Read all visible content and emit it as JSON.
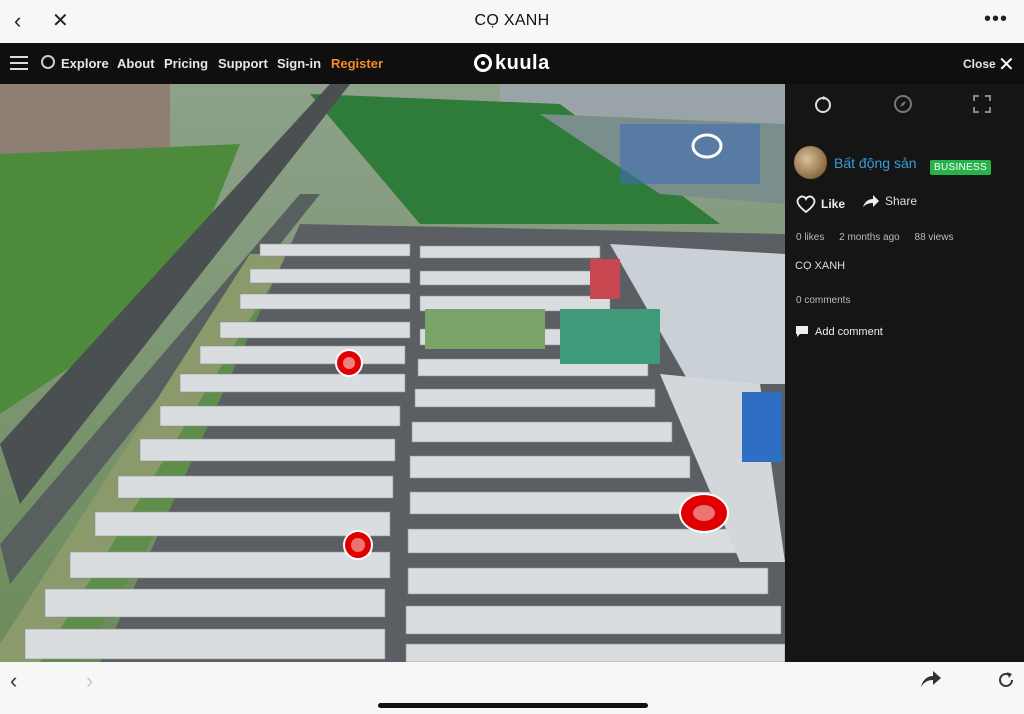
{
  "browser": {
    "title": "CỌ XANH",
    "back_icon": "chevron-left-icon",
    "close_icon": "close-icon",
    "more_label": "•••"
  },
  "nav": {
    "links": [
      "Explore",
      "About",
      "Pricing",
      "Support",
      "Sign-in",
      "Register"
    ],
    "logo_text": "kuula",
    "close_label": "Close",
    "accent": "#f28c28"
  },
  "panel": {
    "user": "Bất động sản",
    "badge": "BUSINESS",
    "like_label": "Like",
    "share_label": "Share",
    "likes": "0 likes",
    "date": "2 months ago",
    "views": "88 views",
    "description": "CỌ XANH",
    "comments": "0 comments",
    "add_comment": "Add comment",
    "link_color": "#3a9ad9",
    "badge_color": "#27b34a"
  },
  "bottom": {
    "back_icon": "chevron-left-icon",
    "forward_icon": "chevron-right-icon",
    "share_icon": "share-arrow-icon",
    "reload_icon": "reload-icon"
  }
}
